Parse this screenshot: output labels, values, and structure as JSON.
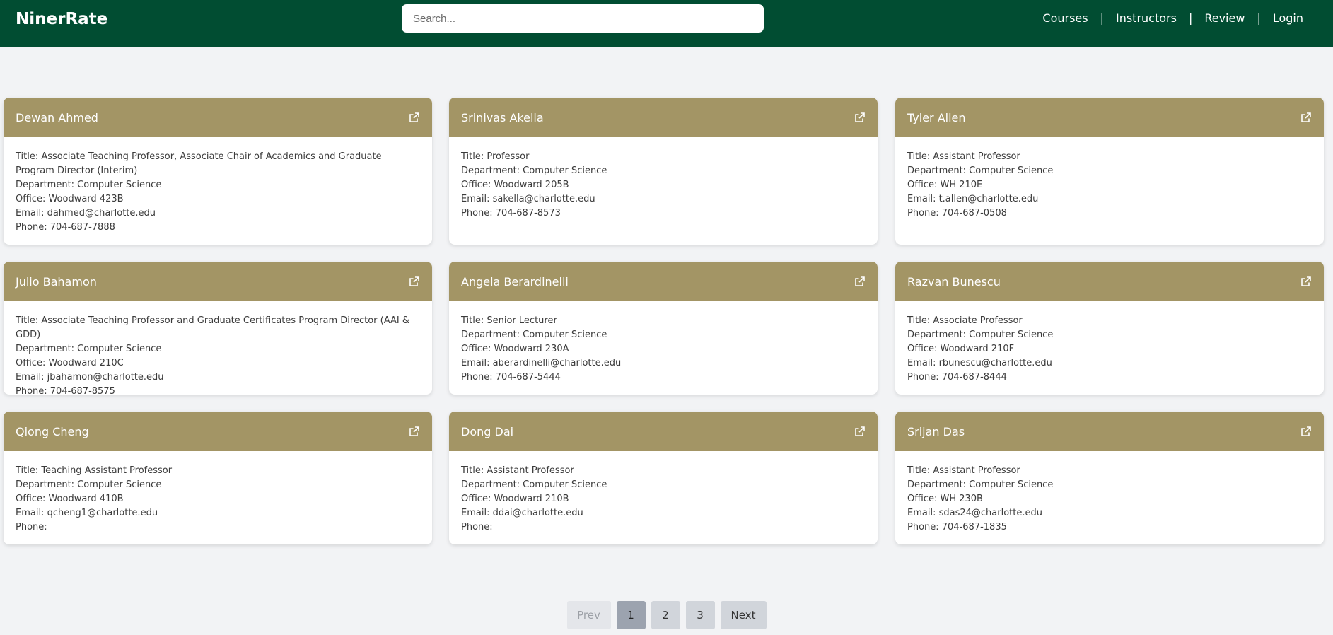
{
  "app": {
    "brand": "NinerRate",
    "search_placeholder": "Search...",
    "nav": [
      {
        "label": "Courses"
      },
      {
        "label": "Instructors"
      },
      {
        "label": "Review"
      },
      {
        "label": "Login"
      }
    ]
  },
  "colors": {
    "navbar": "#014d32",
    "card_header": "#a39565",
    "background": "#f2f3f5"
  },
  "instructors": [
    {
      "name": "Dewan Ahmed",
      "title": "Title: Associate Teaching Professor, Associate Chair of Academics and Graduate Program Director (Interim)",
      "department": "Department: Computer Science",
      "office": "Office: Woodward 423B",
      "email": "Email: dahmed@charlotte.edu",
      "phone": "Phone: 704-687-7888"
    },
    {
      "name": "Srinivas Akella",
      "title": "Title: Professor",
      "department": "Department: Computer Science",
      "office": "Office: Woodward 205B",
      "email": "Email: sakella@charlotte.edu",
      "phone": "Phone: 704-687-8573"
    },
    {
      "name": "Tyler Allen",
      "title": "Title: Assistant Professor",
      "department": "Department: Computer Science",
      "office": "Office: WH 210E",
      "email": "Email: t.allen@charlotte.edu",
      "phone": "Phone: 704-687-0508"
    },
    {
      "name": "Julio Bahamon",
      "title": "Title: Associate Teaching Professor and Graduate Certificates Program Director (AAI & GDD)",
      "department": "Department: Computer Science",
      "office": "Office: Woodward 210C",
      "email": "Email: jbahamon@charlotte.edu",
      "phone": "Phone: 704-687-8575"
    },
    {
      "name": "Angela Berardinelli",
      "title": "Title: Senior Lecturer",
      "department": "Department: Computer Science",
      "office": "Office: Woodward 230A",
      "email": "Email: aberardinelli@charlotte.edu",
      "phone": "Phone: 704-687-5444"
    },
    {
      "name": "Razvan Bunescu",
      "title": "Title: Associate Professor",
      "department": "Department: Computer Science",
      "office": "Office: Woodward 210F",
      "email": "Email: rbunescu@charlotte.edu",
      "phone": "Phone: 704-687-8444"
    },
    {
      "name": "Qiong Cheng",
      "title": "Title: Teaching Assistant Professor",
      "department": "Department: Computer Science",
      "office": "Office: Woodward 410B",
      "email": "Email: qcheng1@charlotte.edu",
      "phone": "Phone:"
    },
    {
      "name": "Dong Dai",
      "title": "Title: Assistant Professor",
      "department": "Department: Computer Science",
      "office": "Office: Woodward 210B",
      "email": "Email: ddai@charlotte.edu",
      "phone": "Phone:"
    },
    {
      "name": "Srijan Das",
      "title": "Title: Assistant Professor",
      "department": "Department: Computer Science",
      "office": "Office: WH 230B",
      "email": "Email: sdas24@charlotte.edu",
      "phone": "Phone: 704-687-1835"
    }
  ],
  "pagination": {
    "prev": "Prev",
    "pages": [
      "1",
      "2",
      "3"
    ],
    "current": "1",
    "next": "Next"
  }
}
